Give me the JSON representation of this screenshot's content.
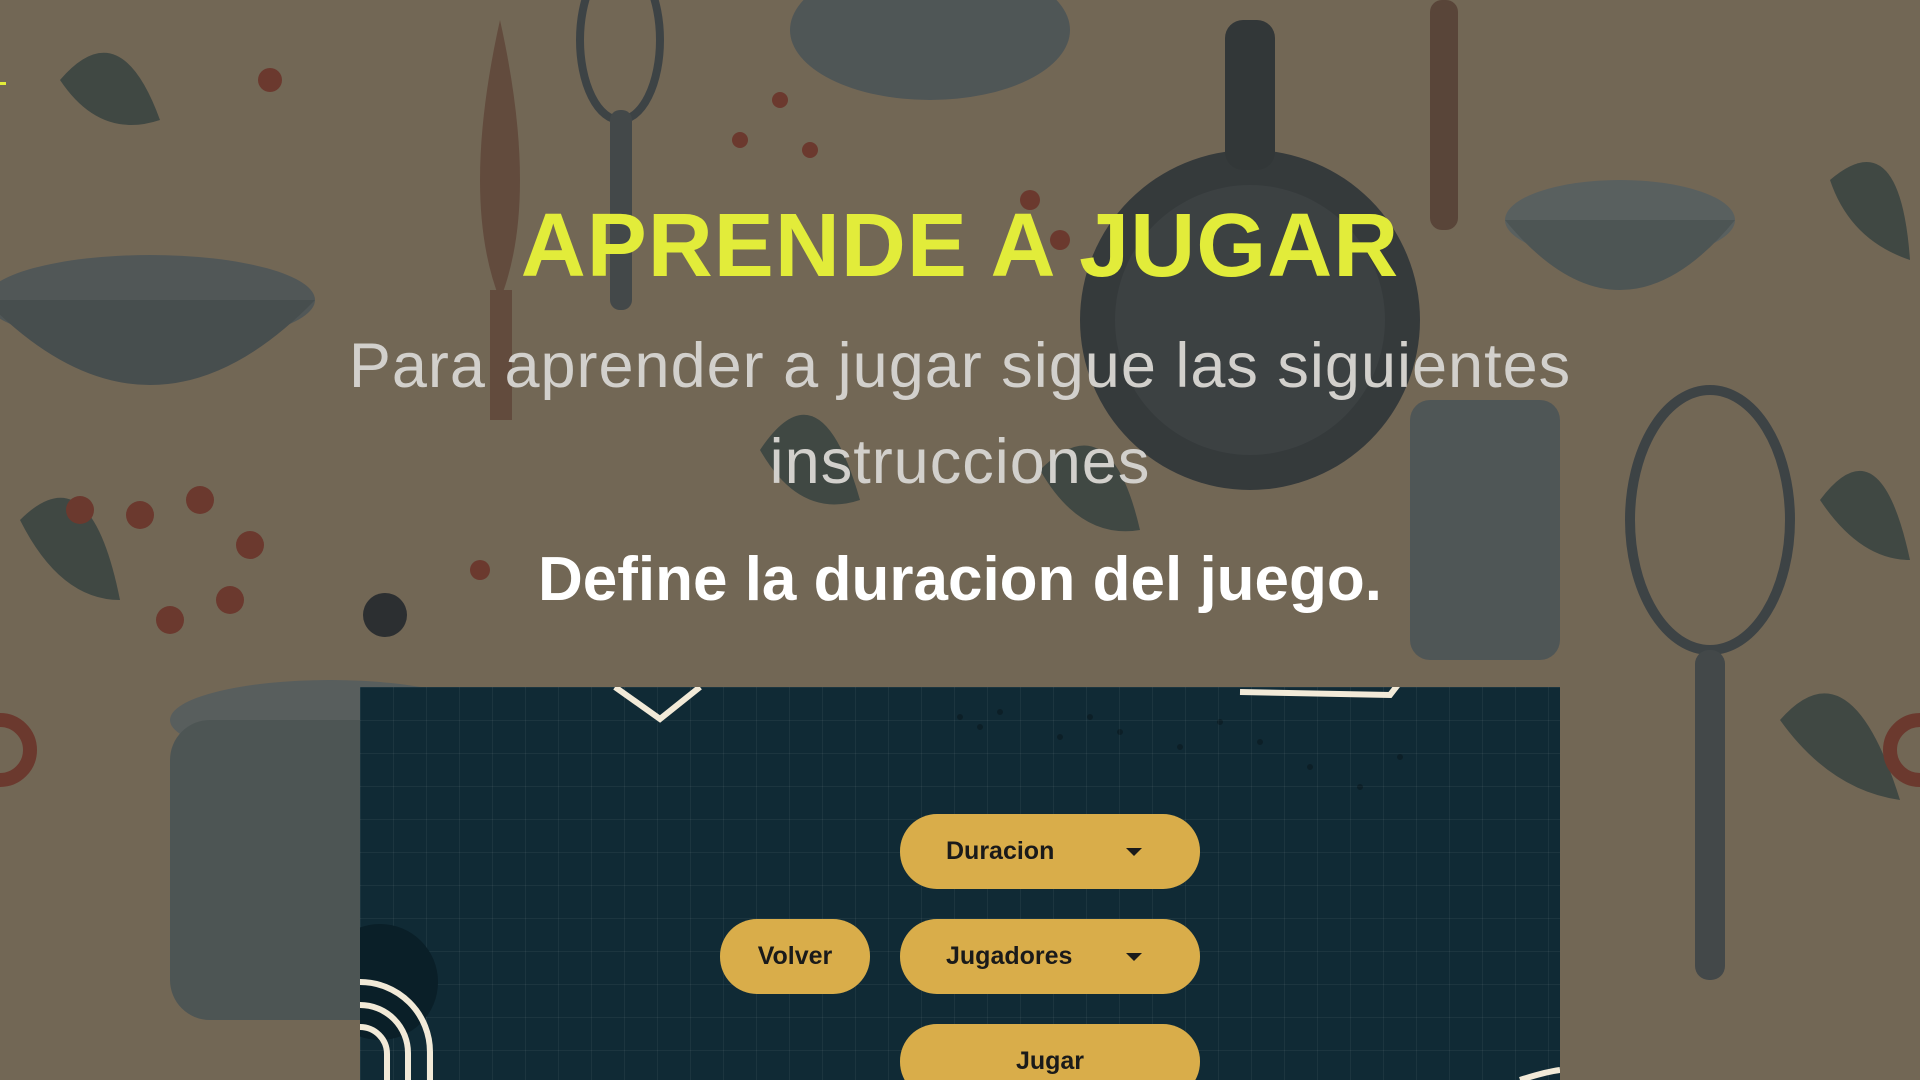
{
  "header": {
    "title": "APRENDE A JUGAR",
    "subtitle": "Para aprender a jugar sigue las siguientes instrucciones",
    "step": "Define la duracion del juego."
  },
  "game": {
    "duration_select": {
      "label": "Duracion",
      "icon": "caret-down-icon"
    },
    "players_select": {
      "label": "Jugadores",
      "icon": "caret-down-icon"
    },
    "back_button": {
      "label": "Volver"
    },
    "play_button": {
      "label": "Jugar"
    }
  },
  "colors": {
    "title": "#e2ec3a",
    "subtitle": "#d2d0cc",
    "step": "#ffffff",
    "game_background": "#102a35",
    "button": "#d9ad4a",
    "button_text": "#1a1a1a"
  }
}
